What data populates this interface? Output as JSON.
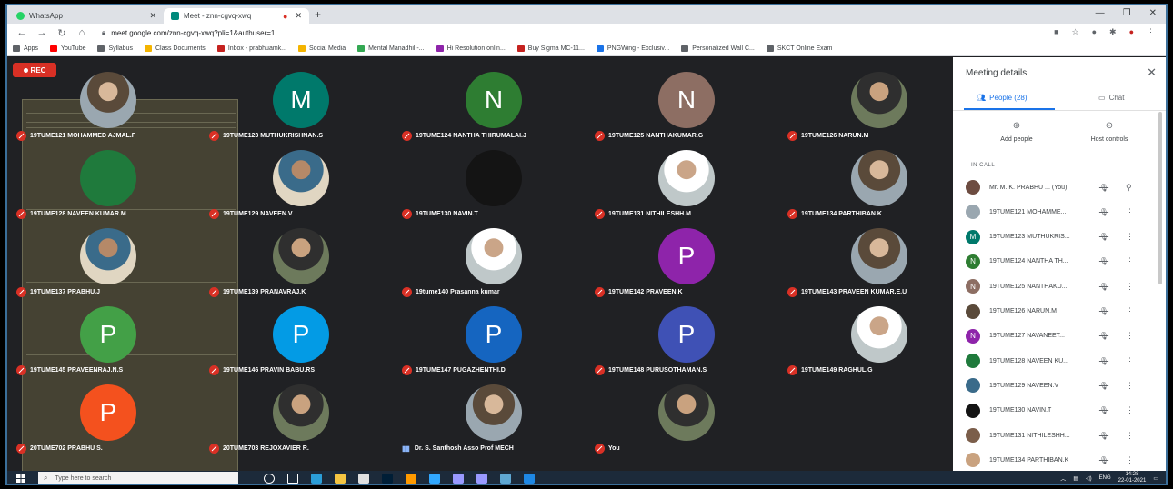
{
  "browser": {
    "tabs": [
      {
        "title": "WhatsApp",
        "favicon_color": "#25d366"
      },
      {
        "title": "Meet - znn-cgvq-xwq",
        "favicon_color": "#00897b"
      }
    ],
    "url": "meet.google.com/znn-cgvq-xwq?pli=1&authuser=1",
    "bookmarks": [
      {
        "label": "Apps",
        "color": "#5f6368"
      },
      {
        "label": "YouTube",
        "color": "#ff0000"
      },
      {
        "label": "Syllabus",
        "color": "#5f6368"
      },
      {
        "label": "Class Documents",
        "color": "#f4b400"
      },
      {
        "label": "Inbox - prabhuamk...",
        "color": "#c5221f"
      },
      {
        "label": "Social Media",
        "color": "#f4b400"
      },
      {
        "label": "Mental Manadhil -...",
        "color": "#34a853"
      },
      {
        "label": "Hi Resolution onlin...",
        "color": "#8e24aa"
      },
      {
        "label": "Buy Sigma MC-11...",
        "color": "#c5221f"
      },
      {
        "label": "PNGWing - Exclusiv...",
        "color": "#1a73e8"
      },
      {
        "label": "Personalized Wall C...",
        "color": "#5f6368"
      },
      {
        "label": "SKCT Online Exam",
        "color": "#5f6368"
      }
    ]
  },
  "meet": {
    "rec_label": "REC",
    "tiles": [
      {
        "name": "19TUME121 MOHAMMED AJMAL.F",
        "initial": "",
        "color": "",
        "style": "photo"
      },
      {
        "name": "19TUME123 MUTHUKRISHNAN.S",
        "initial": "M",
        "color": "#00796b",
        "style": "letter"
      },
      {
        "name": "19TUME124 NANTHA THIRUMALAI.J",
        "initial": "N",
        "color": "#2e7d32",
        "style": "letter"
      },
      {
        "name": "19TUME125 NANTHAKUMAR.G",
        "initial": "N",
        "color": "#8d6e63",
        "style": "letter"
      },
      {
        "name": "19TUME126 NARUN.M",
        "initial": "",
        "color": "",
        "style": "photo2"
      },
      {
        "name": "19TUME128 NAVEEN KUMAR.M",
        "initial": "",
        "color": "",
        "style": "feather"
      },
      {
        "name": "19TUME129 NAVEEN.V",
        "initial": "",
        "color": "",
        "style": "photo4"
      },
      {
        "name": "19TUME130 NAVIN.T",
        "initial": "",
        "color": "",
        "style": "dark"
      },
      {
        "name": "19TUME131 NITHILESHH.M",
        "initial": "",
        "color": "",
        "style": "photo3"
      },
      {
        "name": "19TUME134 PARTHIBAN.K",
        "initial": "",
        "color": "",
        "style": "photo"
      },
      {
        "name": "19TUME137 PRABHU.J",
        "initial": "",
        "color": "",
        "style": "photo4"
      },
      {
        "name": "19TUME139 PRANAVRAJ.K",
        "initial": "",
        "color": "",
        "style": "photo2"
      },
      {
        "name": "19tume140 Prasanna kumar",
        "initial": "",
        "color": "",
        "style": "photo3"
      },
      {
        "name": "19TUME142 PRAVEEN.K",
        "initial": "P",
        "color": "#8e24aa",
        "style": "letter"
      },
      {
        "name": "19TUME143 PRAVEEN KUMAR.E.U",
        "initial": "",
        "color": "",
        "style": "photo"
      },
      {
        "name": "19TUME145 PRAVEENRAJ.N.S",
        "initial": "P",
        "color": "#43a047",
        "style": "letter"
      },
      {
        "name": "19TUME146 PRAVIN BABU.RS",
        "initial": "P",
        "color": "#039be5",
        "style": "letter"
      },
      {
        "name": "19TUME147 PUGAZHENTHI.D",
        "initial": "P",
        "color": "#1565c0",
        "style": "letter"
      },
      {
        "name": "19TUME148 PURUSOTHAMAN.S",
        "initial": "P",
        "color": "#3f51b5",
        "style": "letter"
      },
      {
        "name": "19TUME149 RAGHUL.G",
        "initial": "",
        "color": "",
        "style": "photo3"
      },
      {
        "name": "20TUME702 PRABHU S.",
        "initial": "P",
        "color": "#f4511e",
        "style": "letter"
      },
      {
        "name": "20TUME703 REJOXAVIER R.",
        "initial": "",
        "color": "",
        "style": "photo2"
      },
      {
        "name": "Dr. S. Santhosh Asso Prof MECH",
        "initial": "",
        "color": "",
        "style": "photo",
        "speaking": true
      },
      {
        "name": "You",
        "initial": "",
        "color": "",
        "style": "photo2"
      }
    ]
  },
  "panel": {
    "title": "Meeting details",
    "people_tab": "People (28)",
    "chat_tab": "Chat",
    "add_people": "Add people",
    "host_controls": "Host controls",
    "in_call": "IN CALL",
    "participants": [
      {
        "name": "Mr. M. K. PRABHU ... (You)",
        "initial": "",
        "color": "#6d4c41",
        "more": "pin"
      },
      {
        "name": "19TUME121 MOHAMME...",
        "initial": "",
        "color": "#9aa7b0",
        "more": "dots"
      },
      {
        "name": "19TUME123 MUTHUKRIS...",
        "initial": "M",
        "color": "#00796b",
        "more": "dots"
      },
      {
        "name": "19TUME124 NANTHA TH...",
        "initial": "N",
        "color": "#2e7d32",
        "more": "dots"
      },
      {
        "name": "19TUME125 NANTHAKU...",
        "initial": "N",
        "color": "#8d6e63",
        "more": "dots"
      },
      {
        "name": "19TUME126 NARUN.M",
        "initial": "",
        "color": "#5a4a3a",
        "more": "dots"
      },
      {
        "name": "19TUME127 NAVANEET...",
        "initial": "N",
        "color": "#8e24aa",
        "more": "dots"
      },
      {
        "name": "19TUME128 NAVEEN KU...",
        "initial": "",
        "color": "#1f7a3c",
        "more": "dots"
      },
      {
        "name": "19TUME129 NAVEEN.V",
        "initial": "",
        "color": "#3a6b8a",
        "more": "dots"
      },
      {
        "name": "19TUME130 NAVIN.T",
        "initial": "",
        "color": "#141414",
        "more": "dots"
      },
      {
        "name": "19TUME131 NITHILESHH...",
        "initial": "",
        "color": "#7b5e4a",
        "more": "dots"
      },
      {
        "name": "19TUME134 PARTHIBAN.K",
        "initial": "",
        "color": "#c9a27f",
        "more": "dots"
      }
    ]
  },
  "taskbar": {
    "search_placeholder": "Type here to search",
    "lang": "ENG",
    "time": "14:28",
    "date": "22-01-2021",
    "apps": [
      {
        "name": "cortana",
        "color": "#ffffff"
      },
      {
        "name": "task-view",
        "color": "#ffffff"
      },
      {
        "name": "edge",
        "color": "#2b9ed8"
      },
      {
        "name": "file-explorer",
        "color": "#f4c542"
      },
      {
        "name": "chrome",
        "color": "#e0e0e0"
      },
      {
        "name": "photoshop",
        "color": "#001e36"
      },
      {
        "name": "illustrator",
        "color": "#ff9a00"
      },
      {
        "name": "lightroom",
        "color": "#31a8ff"
      },
      {
        "name": "after-effects",
        "color": "#9999ff"
      },
      {
        "name": "premiere",
        "color": "#9999ff"
      },
      {
        "name": "paint",
        "color": "#5fa8d3"
      },
      {
        "name": "photos",
        "color": "#1e88e5"
      }
    ]
  }
}
